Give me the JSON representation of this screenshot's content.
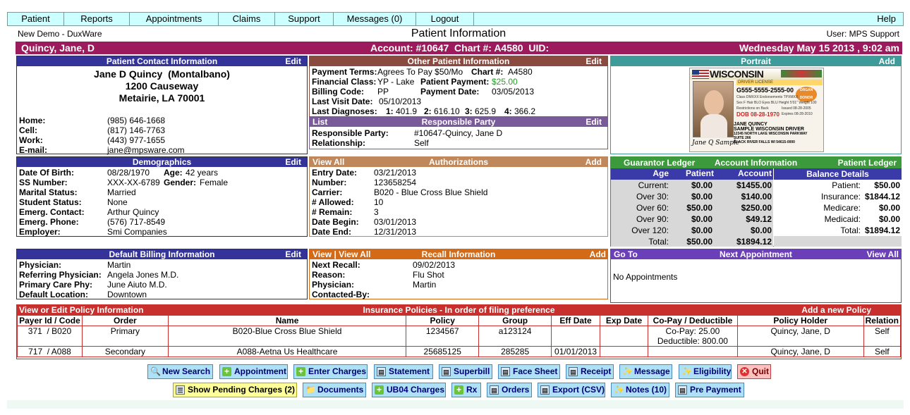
{
  "menu": {
    "items": [
      "Patient",
      "Reports",
      "Appointments",
      "Claims",
      "Support",
      "Messages (0)",
      "Logout"
    ],
    "help": "Help"
  },
  "header": {
    "app_name": "New Demo - DuxWare",
    "title": "Patient Information",
    "user": "User: MPS Support"
  },
  "patient_bar": {
    "name": "Quincy, Jane, D",
    "account": "Account: #10647  Chart #: A4580  UID:",
    "datetime": "Wednesday May 15 2013 , 9:02 am"
  },
  "contact": {
    "header": "Patient Contact Information",
    "edit": "Edit",
    "name": "Jane D Quincy  (Montalbano)",
    "street": "1200 Causeway",
    "city": "Metairie, LA  70001",
    "rows": [
      {
        "label": "Home:",
        "value": "(985) 646-1668"
      },
      {
        "label": "Cell:",
        "value": "(817) 146-7763"
      },
      {
        "label": "Work:",
        "value": "(443) 977-1655"
      },
      {
        "label": "E-mail:",
        "value": "jane@mpsware.com"
      }
    ]
  },
  "other": {
    "header": "Other Patient Information",
    "edit": "Edit",
    "payment_terms_label": "Payment Terms:",
    "payment_terms": "Agrees To Pay $50/Mo",
    "chart_label": "Chart #:",
    "chart": "A4580",
    "financial_class_label": "Financial Class:",
    "financial_class": "YP - Lake",
    "patient_payment_label": "Patient Payment:",
    "patient_payment": "$25.00",
    "billing_code_label": "Billing Code:",
    "billing_code": "PP",
    "payment_date_label": "Payment Date:",
    "payment_date": "03/05/2013",
    "last_visit_label": "Last Visit Date:",
    "last_visit": "05/10/2013",
    "last_dx_label": "Last Diagnoses:",
    "dx": [
      "1:",
      "401.9",
      "2:",
      "616.10",
      "3:",
      "625.9",
      "4:",
      "366.2"
    ]
  },
  "responsible": {
    "list": "List",
    "header": "Responsible Party",
    "edit": "Edit",
    "party_label": "Responsible Party:",
    "party": "#10647-Quincy, Jane D",
    "relationship_label": "Relationship:",
    "relationship": "Self"
  },
  "portrait": {
    "header": "Portrait",
    "add": "Add",
    "card": {
      "state": "WISCONSIN",
      "type": "DRIVER LICENSE",
      "number": "G555-5555-2555-00",
      "class": "Class DMXXX  Endorsements TPXMXX",
      "details": "Sex F  Hair BLO  Eyes BLU  Height 5'01\"  Weight 100",
      "dob": "DOB 08-28-1970",
      "name1": "JANE QUINCY",
      "name2": "SAMPLE WISCONSIN DRIVER",
      "addr1": "12345 NORTH LAKE WISCONSIN PARKWAY",
      "addr2": "SUITE 266",
      "addr3": "BLACK RIVER FALLS  WI  54615-0000",
      "signature": "Jane Q Sample",
      "badge": "ORGAN DONOR",
      "issued": "Issued 08-28-2005",
      "expires": "Expires 08-28-2010",
      "restrictions": "Restrictions on Back"
    }
  },
  "demographics": {
    "header": "Demographics",
    "edit": "Edit",
    "dob_label": "Date Of Birth:",
    "dob": "08/28/1970",
    "age_label": "Age:",
    "age": "42 years",
    "ssn_label": "SS Number:",
    "ssn": "XXX-XX-6789",
    "gender_label": "Gender:",
    "gender": "Female",
    "rows": [
      {
        "label": "Marital Status:",
        "value": "Married"
      },
      {
        "label": "Student Status:",
        "value": "None"
      },
      {
        "label": "Emerg. Contact:",
        "value": "Arthur Quincy"
      },
      {
        "label": "Emerg. Phone:",
        "value": "(576) 717-8549"
      },
      {
        "label": "Employer:",
        "value": "Smi Companies"
      }
    ]
  },
  "authorizations": {
    "view_all": "View All",
    "header": "Authorizations",
    "add": "Add",
    "rows": [
      {
        "label": "Entry Date:",
        "value": "03/21/2013"
      },
      {
        "label": "Number:",
        "value": "123658254"
      },
      {
        "label": "Carrier:",
        "value": "B020 - Blue Cross Blue Shield"
      },
      {
        "label": "# Allowed:",
        "value": "10"
      },
      {
        "label": "# Remain:",
        "value": "3"
      },
      {
        "label": "Date Begin:",
        "value": "03/01/2013"
      },
      {
        "label": "Date End:",
        "value": "12/31/2013"
      }
    ]
  },
  "ledger": {
    "guarantor": "Guarantor Ledger",
    "account_info": "Account Information",
    "patient_ledger": "Patient Ledger",
    "cols": [
      "Age",
      "Patient",
      "Account"
    ],
    "balance_header": "Balance Details",
    "rows": [
      {
        "age": "Current:",
        "patient": "$0.00",
        "account": "$1455.00"
      },
      {
        "age": "Over 30:",
        "patient": "$0.00",
        "account": "$140.00"
      },
      {
        "age": "Over 60:",
        "patient": "$50.00",
        "account": "$250.00"
      },
      {
        "age": "Over 90:",
        "patient": "$0.00",
        "account": "$49.12"
      },
      {
        "age": "Over 120:",
        "patient": "$0.00",
        "account": "$0.00"
      },
      {
        "age": "Total:",
        "patient": "$50.00",
        "account": "$1894.12"
      }
    ],
    "balance": [
      {
        "label": "Patient:",
        "value": "$50.00"
      },
      {
        "label": "Insurance:",
        "value": "$1844.12"
      },
      {
        "label": "Medicare:",
        "value": "$0.00"
      },
      {
        "label": "Medicaid:",
        "value": "$0.00"
      },
      {
        "label": "Total:",
        "value": "$1894.12"
      }
    ]
  },
  "billing": {
    "header": "Default Billing Information",
    "edit": "Edit",
    "rows": [
      {
        "label": "Physician:",
        "value": "Martin"
      },
      {
        "label": "Referring Physician:",
        "value": "Angela Jones M.D."
      },
      {
        "label": "Primary Care Phy:",
        "value": "June Aiuto M.D."
      },
      {
        "label": "Default Location:",
        "value": "Downtown"
      }
    ]
  },
  "recall": {
    "view_links": "View | View All",
    "header": "Recall Information",
    "add": "Add",
    "rows": [
      {
        "label": "Next Recall:",
        "value": "09/02/2013"
      },
      {
        "label": "Reason:",
        "value": "Flu Shot"
      },
      {
        "label": "Physician:",
        "value": "Martin"
      },
      {
        "label": "Contacted-By:",
        "value": ""
      }
    ]
  },
  "appointment": {
    "goto": "Go To",
    "header": "Next Appointment",
    "view_all": "View All",
    "empty": "No Appointments"
  },
  "policies": {
    "left": "View or Edit Policy Information",
    "header": "Insurance Policies - In order of filing preference",
    "add": "Add a new Policy",
    "columns": [
      "Payer Id / Code",
      "Order",
      "Name",
      "Policy",
      "Group",
      "Eff Date",
      "Exp Date",
      "Co-Pay / Deductible",
      "Policy Holder",
      "Relation"
    ],
    "rows": [
      {
        "payer": "371  / B020",
        "order": "Primary",
        "name": "B020-Blue Cross Blue Shield",
        "policy": "1234567",
        "group": "a123124",
        "eff": "",
        "exp": "",
        "copay": "Co-Pay: 25.00",
        "deductible": "Deductible: 800.00",
        "holder": "Quincy, Jane, D",
        "relation": "Self"
      },
      {
        "payer": "717  / A088",
        "order": "Secondary",
        "name": "A088-Aetna Us Healthcare",
        "policy": "25685125",
        "group": "285285",
        "eff": "01/01/2013",
        "exp": "",
        "copay": "",
        "deductible": "",
        "holder": "Quincy, Jane, D",
        "relation": "Self"
      }
    ]
  },
  "buttons_row1": [
    {
      "label": "New Search",
      "icon": "search-icon"
    },
    {
      "label": "Appointment",
      "icon": "plus-icon"
    },
    {
      "label": "Enter Charges",
      "icon": "plus-icon"
    },
    {
      "label": "Statement",
      "icon": "printer-icon"
    },
    {
      "label": "Superbill",
      "icon": "printer-icon"
    },
    {
      "label": "Face Sheet",
      "icon": "printer-icon"
    },
    {
      "label": "Receipt",
      "icon": "printer-icon"
    },
    {
      "label": "Message",
      "icon": "star-icon"
    },
    {
      "label": "Eligibility",
      "icon": "star-icon"
    },
    {
      "label": "Quit",
      "icon": "close-icon"
    }
  ],
  "buttons_row2": [
    {
      "label": "Show Pending Charges (2)",
      "icon": "list-icon"
    },
    {
      "label": "Documents",
      "icon": "folder-icon"
    },
    {
      "label": "UB04 Charges",
      "icon": "plus-icon"
    },
    {
      "label": "Rx",
      "icon": "plus-icon"
    },
    {
      "label": "Orders",
      "icon": "printer-icon"
    },
    {
      "label": "Export (CSV)",
      "icon": "document-icon"
    },
    {
      "label": "Notes (10)",
      "icon": "star-icon"
    },
    {
      "label": "Pre Payment",
      "icon": "document-icon"
    }
  ],
  "colors": {
    "patient_bar": "#9b1b5c",
    "blue_header": "#33339a",
    "brown_header": "#8b4a3f",
    "green_header": "#3c9a3c",
    "red_header": "#c8302e",
    "menu_bg": "#ccffff",
    "green_text": "#2a9a2a"
  }
}
